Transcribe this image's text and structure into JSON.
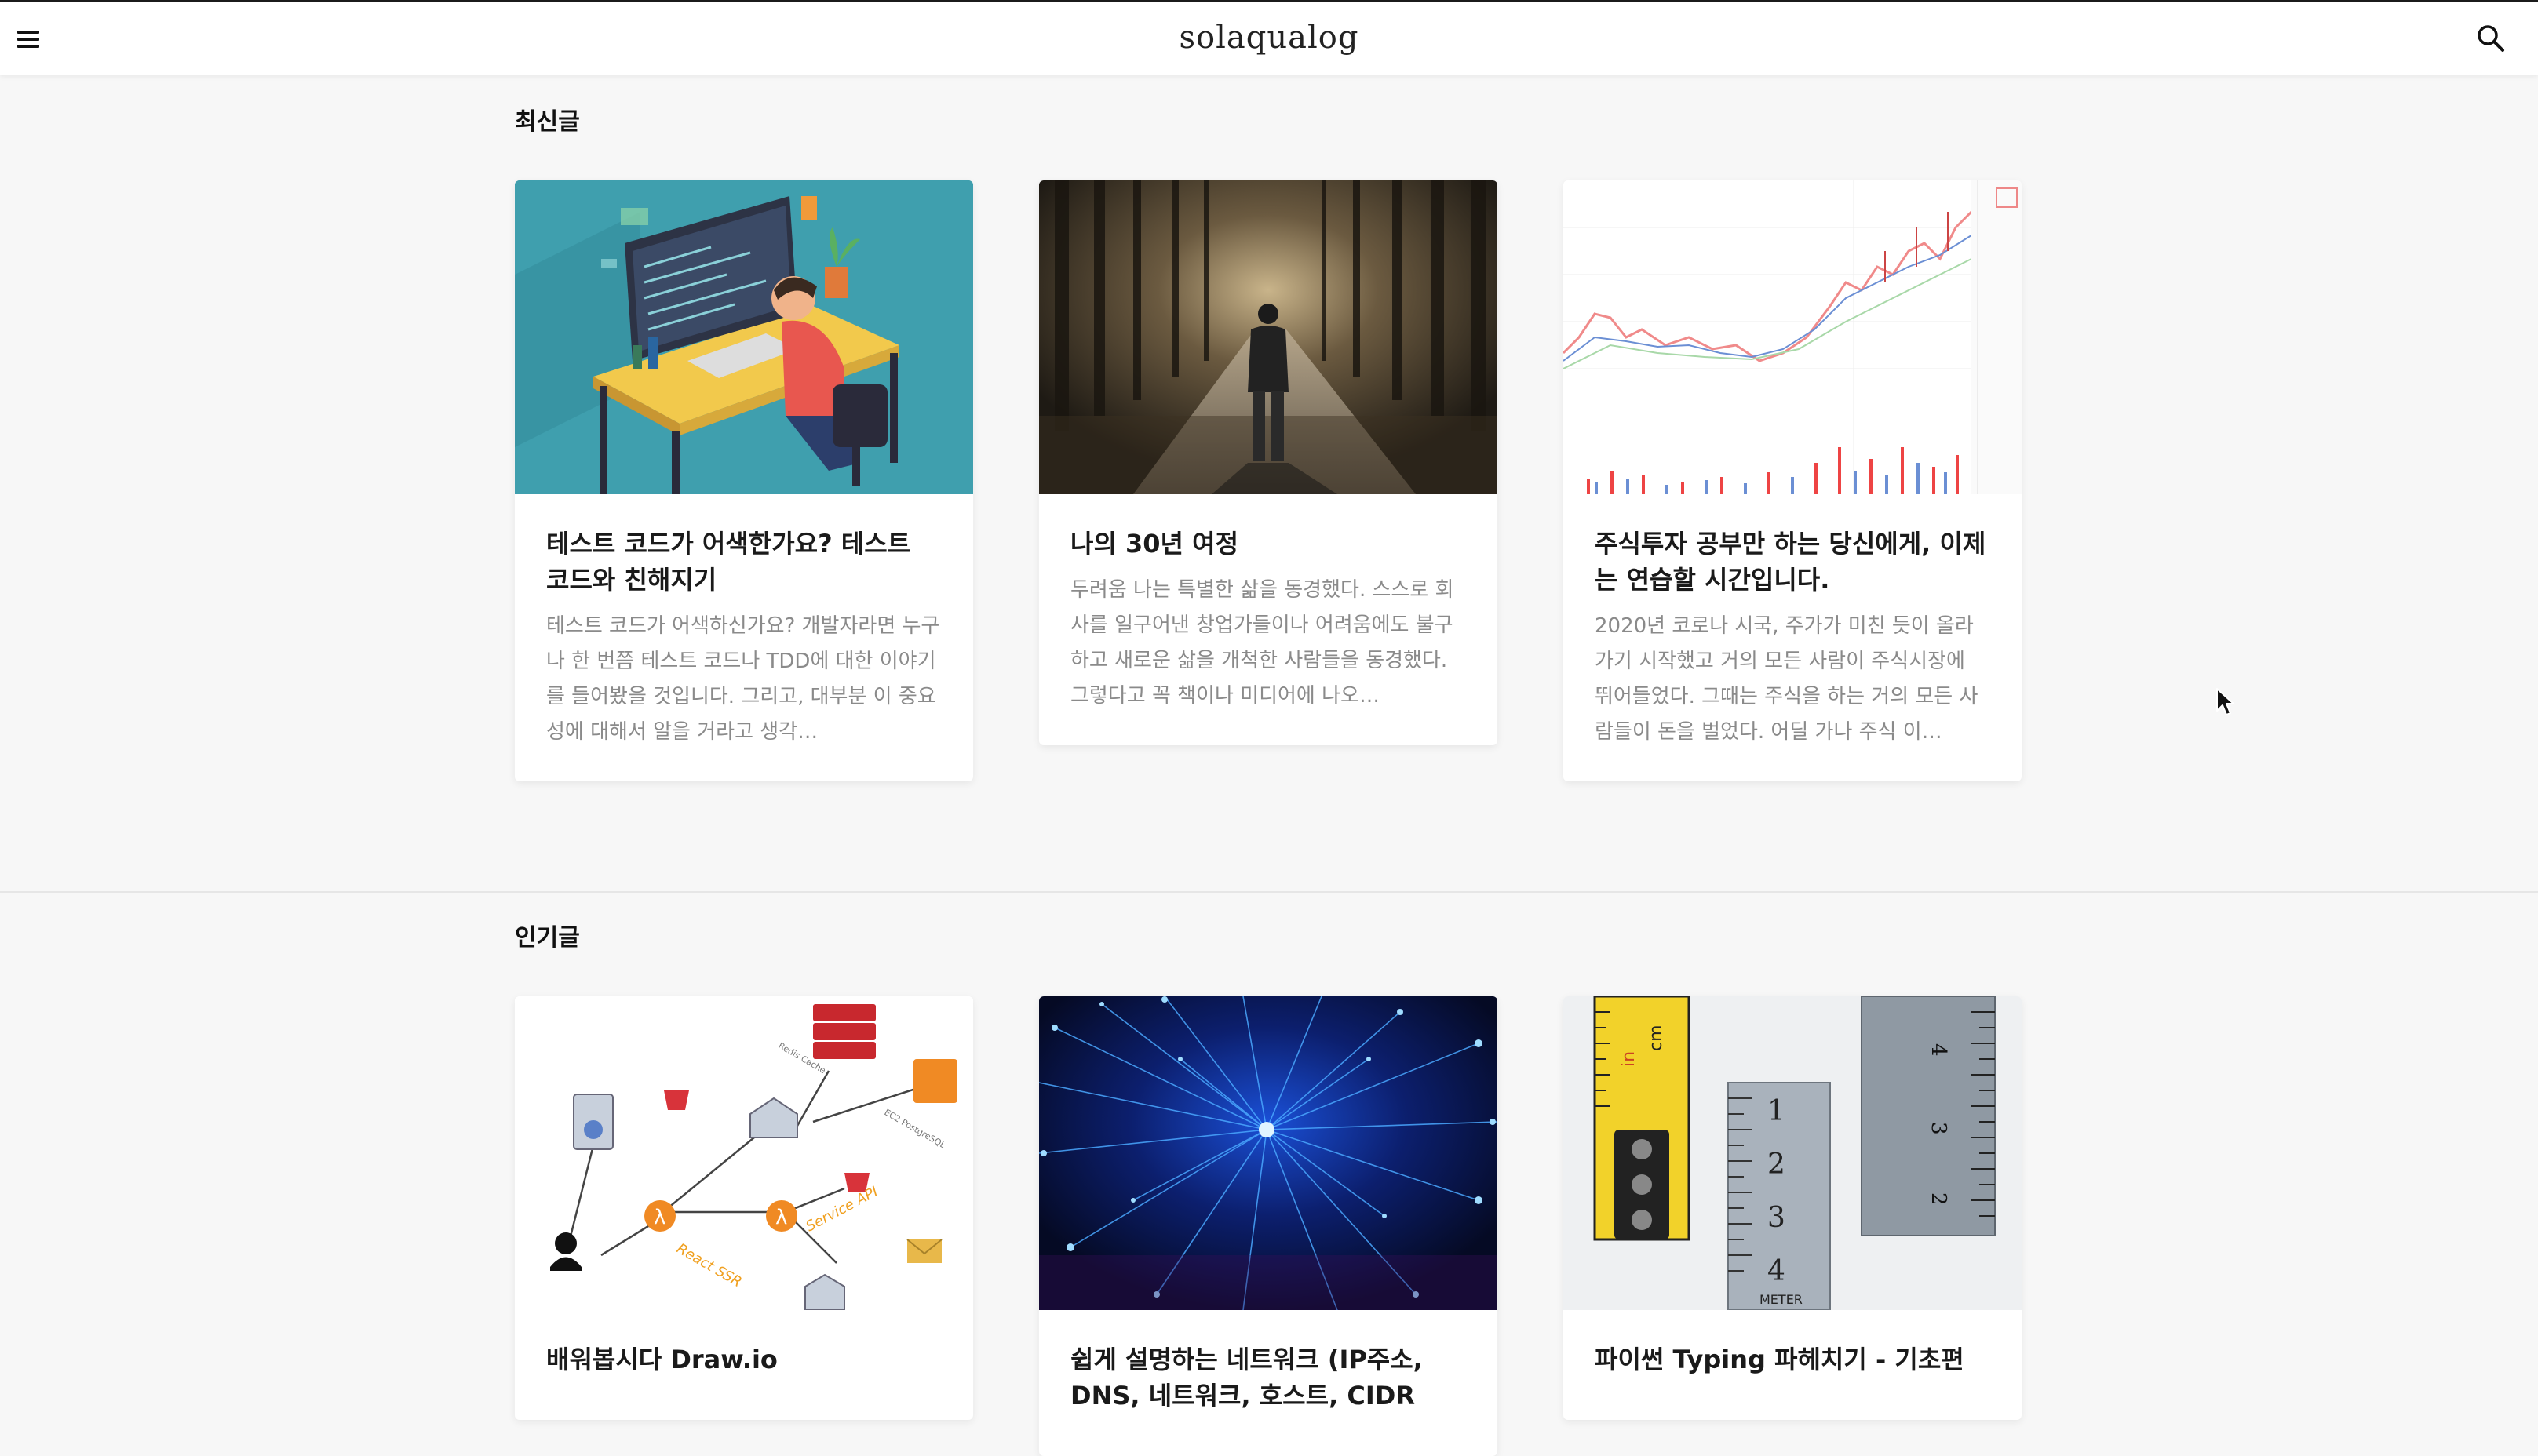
{
  "header": {
    "brand": "solaqualog",
    "menu_icon": "hamburger-menu-icon",
    "search_icon": "search-icon"
  },
  "sections": {
    "latest": {
      "title": "최신글",
      "cards": [
        {
          "title": "테스트 코드가 어색한가요? 테스트 코드와 친해지기",
          "excerpt": "테스트 코드가 어색하신가요? 개발자라면 누구나 한 번쯤 테스트 코드나 TDD에 대한 이야기를 들어봤을 것입니다. 그리고, 대부분 이 중요성에 대해서 알을 거라고 생각…",
          "image": "developer-at-desk-illustration"
        },
        {
          "title": "나의 30년 여정",
          "excerpt": "두려움 나는 특별한 삶을 동경했다. 스스로 회사를 일구어낸 창업가들이나 어려움에도 불구하고 새로운 삶을 개척한 사람들을 동경했다. 그렇다고 꼭 책이나 미디어에 나오…",
          "image": "person-on-forest-path-photo"
        },
        {
          "title": "주식투자 공부만 하는 당신에게, 이제는 연습할 시간입니다.",
          "excerpt": "2020년 코로나 시국, 주가가 미친 듯이 올라가기 시작했고 거의 모든 사람이 주식시장에 뛰어들었다. 그때는 주식을 하는 거의 모든 사람들이 돈을 벌었다. 어딜 가나 주식 이…",
          "image": "stock-candlestick-chart"
        }
      ]
    },
    "popular": {
      "title": "인기글",
      "cards": [
        {
          "title": "배워봅시다 Draw.io",
          "image": "aws-architecture-diagram",
          "diagram_labels": [
            "React SSR",
            "Service API",
            "Redis Cache",
            "EC2 PostgreSQL"
          ]
        },
        {
          "title": "쉽게 설명하는 네트워크 (IP주소, DNS, 네트워크, 호스트, CIDR",
          "image": "blue-network-fiber-photo"
        },
        {
          "title": "파이썬 Typing 파헤치기 - 기초편",
          "image": "measuring-tapes-photo",
          "tape_labels": [
            "1",
            "2",
            "3",
            "4",
            "METER",
            "cm",
            "in"
          ]
        }
      ]
    }
  },
  "colors": {
    "background": "#f7f7f7",
    "card": "#ffffff",
    "title": "#1a1a1a",
    "excerpt": "#8a8a8a"
  }
}
